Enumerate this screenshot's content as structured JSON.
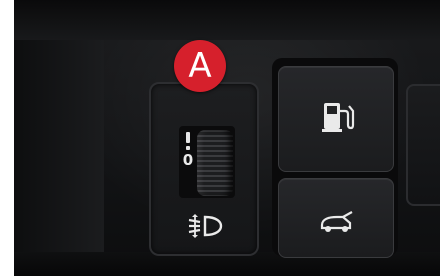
{
  "callout": {
    "label": "A"
  },
  "leveling_control": {
    "scale_top": "",
    "scale_zero": "0",
    "icon": "headlamp-leveling-icon"
  },
  "switches": [
    {
      "icon": "fuel-door-icon"
    },
    {
      "icon": "trunk-open-icon"
    }
  ],
  "colors": {
    "callout_red": "#d6202c",
    "panel_dark": "#1a1b1d",
    "symbol_white": "#eaeaea"
  }
}
